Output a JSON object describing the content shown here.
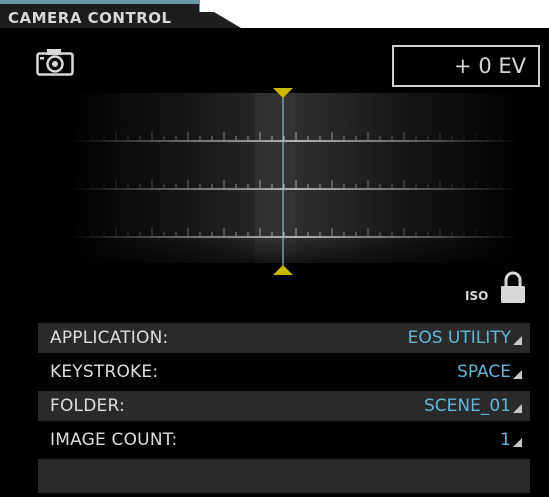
{
  "tab": {
    "title": "CAMERA CONTROL"
  },
  "exposure": {
    "value": "+ 0 EV"
  },
  "iso": {
    "label": "ISO",
    "locked": true
  },
  "settings": {
    "rows": [
      {
        "label": "APPLICATION:",
        "value": "EOS UTILITY"
      },
      {
        "label": "KEYSTROKE:",
        "value": "SPACE"
      },
      {
        "label": "FOLDER:",
        "value": "SCENE_01"
      },
      {
        "label": "IMAGE COUNT:",
        "value": "1"
      }
    ]
  },
  "colors": {
    "accent": "#62b7d7",
    "marker": "#c8b800",
    "tab_border": "#6a97a3"
  },
  "icons": {
    "camera": "camera-icon",
    "lock": "lock-icon",
    "dropdown": "dropdown-arrow-icon"
  }
}
